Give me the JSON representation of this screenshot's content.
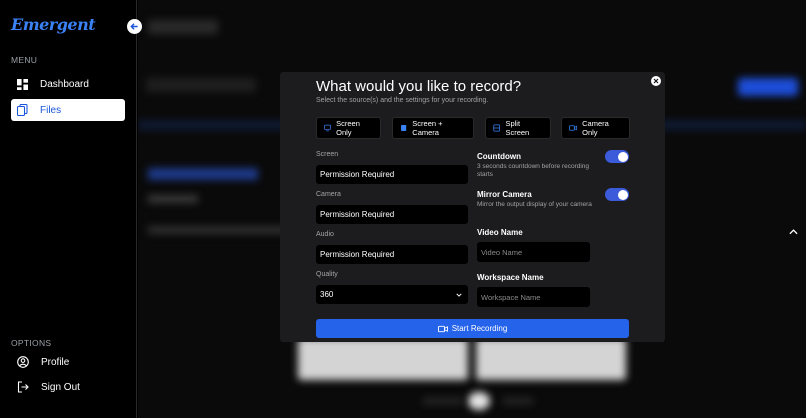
{
  "brand": "Emergent",
  "sidebar": {
    "menu_label": "MENU",
    "items": [
      {
        "label": "Dashboard"
      },
      {
        "label": "Files"
      }
    ],
    "options_label": "OPTIONS",
    "options": [
      {
        "label": "Profile"
      },
      {
        "label": "Sign Out"
      }
    ]
  },
  "modal": {
    "title": "What would you like to record?",
    "subtitle": "Select the source(s) and the settings for your recording.",
    "sources": [
      {
        "label": "Screen Only",
        "icon": "monitor-icon"
      },
      {
        "label": "Screen + Camera",
        "icon": "screen-camera-icon"
      },
      {
        "label": "Split Screen",
        "icon": "split-screen-icon"
      },
      {
        "label": "Camera Only",
        "icon": "video-camera-icon"
      }
    ],
    "screen_label": "Screen",
    "screen_value": "Permission Required",
    "camera_label": "Camera",
    "camera_value": "Permission Required",
    "audio_label": "Audio",
    "audio_value": "Permission Required",
    "quality_label": "Quality",
    "quality_value": "360",
    "countdown_title": "Countdown",
    "countdown_desc": "3 seconds countdown before recording starts",
    "countdown_on": true,
    "mirror_title": "Mirror Camera",
    "mirror_desc": "Mirror the output display of your camera",
    "mirror_on": true,
    "video_name_label": "Video Name",
    "video_name_placeholder": "Video Name",
    "workspace_name_label": "Workspace Name",
    "workspace_name_placeholder": "Workspace Name",
    "start_label": "Start Recording"
  },
  "colors": {
    "accent": "#2563eb",
    "brand": "#3b82f6",
    "toggle": "#3b5bdb"
  }
}
